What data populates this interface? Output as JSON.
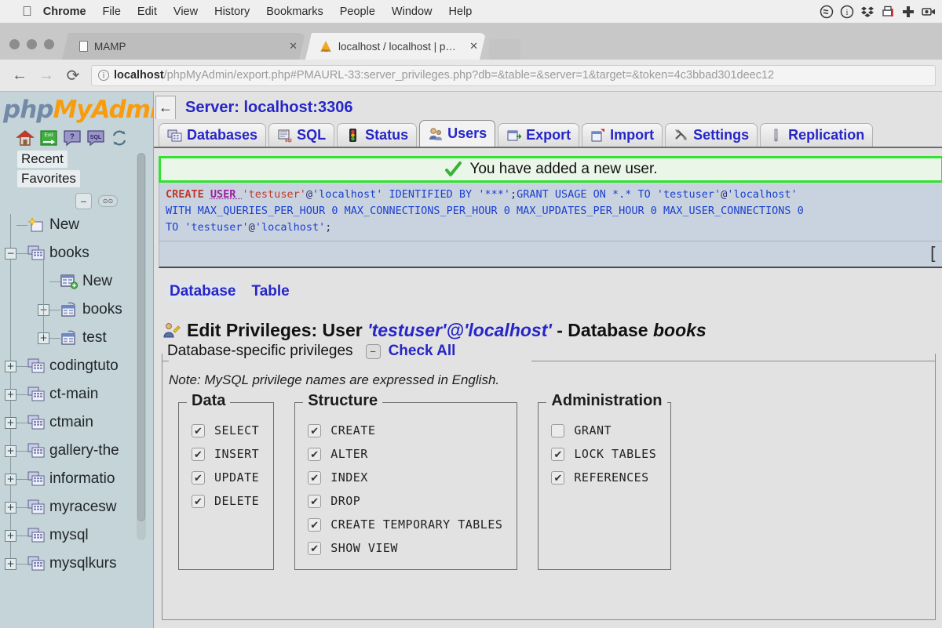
{
  "osmenu": {
    "apple": "apple-logo",
    "items": [
      "Chrome",
      "File",
      "Edit",
      "View",
      "History",
      "Bookmarks",
      "People",
      "Window",
      "Help"
    ],
    "tray": [
      "creative-cloud-icon",
      "info-circle-icon",
      "dropbox-icon",
      "printer-icon",
      "plus-cross-icon",
      "screen-record-icon"
    ]
  },
  "browser": {
    "tabs": [
      {
        "title": "MAMP",
        "close": "✕",
        "active": false
      },
      {
        "title": "localhost / localhost | phpMyA",
        "close": "✕",
        "active": true
      }
    ],
    "nav": {
      "back": "←",
      "forward": "→",
      "reload": "⟳"
    },
    "url_secure_label": "localhost",
    "url_rest": "/phpMyAdmin/export.php#PMAURL-33:server_privileges.php?db=&table=&server=1&target=&token=4c3bbad301deec12"
  },
  "sidebar": {
    "logo_php": "php",
    "logo_myadmin": "MyAdmi",
    "icons": [
      "home-icon",
      "logout-icon",
      "docs-icon",
      "sql-docs-icon",
      "reload-icon"
    ],
    "quicklinks": [
      "Recent",
      "Favorites"
    ],
    "collapse_all": "−",
    "toggle_btn": "⊙⊙",
    "tree": [
      {
        "label": "New",
        "indent": 1,
        "expander": "none",
        "icon": "new-db-icon"
      },
      {
        "label": "books",
        "indent": 1,
        "expander": "−",
        "icon": "database-icon"
      },
      {
        "label": "New",
        "indent": 2,
        "expander": "none",
        "icon": "new-table-icon"
      },
      {
        "label": "books",
        "indent": 2,
        "expander": "+",
        "icon": "table-icon"
      },
      {
        "label": "test",
        "indent": 2,
        "expander": "+",
        "icon": "table-icon"
      },
      {
        "label": "codingtuto",
        "indent": 1,
        "expander": "+",
        "icon": "database-icon"
      },
      {
        "label": "ct-main",
        "indent": 1,
        "expander": "+",
        "icon": "database-icon"
      },
      {
        "label": "ctmain",
        "indent": 1,
        "expander": "+",
        "icon": "database-icon"
      },
      {
        "label": "gallery-the",
        "indent": 1,
        "expander": "+",
        "icon": "database-icon"
      },
      {
        "label": "informatio",
        "indent": 1,
        "expander": "+",
        "icon": "database-icon"
      },
      {
        "label": "myracesw",
        "indent": 1,
        "expander": "+",
        "icon": "database-icon"
      },
      {
        "label": "mysql",
        "indent": 1,
        "expander": "+",
        "icon": "database-icon"
      },
      {
        "label": "mysqlkurs",
        "indent": 1,
        "expander": "+",
        "icon": "database-icon"
      }
    ]
  },
  "main": {
    "back_arrow": "←",
    "server_title": "Server: localhost:3306",
    "tabs": [
      {
        "label": "Databases",
        "icon": "databases-icon",
        "active": false
      },
      {
        "label": "SQL",
        "icon": "sql-icon",
        "active": false
      },
      {
        "label": "Status",
        "icon": "status-icon",
        "active": false
      },
      {
        "label": "Users",
        "icon": "users-icon",
        "active": true
      },
      {
        "label": "Export",
        "icon": "export-icon",
        "active": false
      },
      {
        "label": "Import",
        "icon": "import-icon",
        "active": false
      },
      {
        "label": "Settings",
        "icon": "settings-icon",
        "active": false
      },
      {
        "label": "Replication",
        "icon": "replication-icon",
        "active": false
      }
    ],
    "alert": {
      "icon": "green-check-icon",
      "message": "You have added a new user."
    },
    "sql": {
      "line1": [
        {
          "t": "CREATE ",
          "c": "kw"
        },
        {
          "t": "USER ",
          "c": "kw2"
        },
        {
          "t": "'testuser'",
          "c": "lit"
        },
        {
          "t": "@",
          "c": "pl"
        },
        {
          "t": "'localhost' ",
          "c": "blue"
        },
        {
          "t": "IDENTIFIED BY ",
          "c": "blue"
        },
        {
          "t": "'***'",
          "c": "blue"
        },
        {
          "t": ";",
          "c": "pl"
        },
        {
          "t": "GRANT USAGE ON *.* TO ",
          "c": "blue"
        },
        {
          "t": "'testuser'",
          "c": "blue"
        },
        {
          "t": "@",
          "c": "pl"
        },
        {
          "t": "'localhost'",
          "c": "blue"
        }
      ],
      "line2": [
        {
          "t": "WITH MAX_QUERIES_PER_HOUR 0 MAX_CONNECTIONS_PER_HOUR 0 MAX_UPDATES_PER_HOUR 0 MAX_USER_CONNECTIONS 0",
          "c": "blue"
        }
      ],
      "line3": [
        {
          "t": "TO ",
          "c": "blue"
        },
        {
          "t": "'testuser'",
          "c": "blue"
        },
        {
          "t": "@",
          "c": "pl"
        },
        {
          "t": "'localhost'",
          "c": "blue"
        },
        {
          "t": ";",
          "c": "pl"
        }
      ],
      "edit_bracket": "["
    },
    "subnav": [
      {
        "label": "Database",
        "selected": true
      },
      {
        "label": "Table",
        "selected": false
      }
    ],
    "edit_priv": {
      "icon": "user-privileges-icon",
      "prefix": "Edit Privileges: User ",
      "user": "'testuser'@'localhost'",
      "middle": " - Database ",
      "database": "books"
    },
    "fieldset": {
      "legend": "Database-specific privileges",
      "minus": "−",
      "check_all": "Check All"
    },
    "note": "Note: MySQL privilege names are expressed in English.",
    "priv_groups": [
      {
        "title": "Data",
        "items": [
          {
            "name": "SELECT",
            "checked": true
          },
          {
            "name": "INSERT",
            "checked": true
          },
          {
            "name": "UPDATE",
            "checked": true
          },
          {
            "name": "DELETE",
            "checked": true
          }
        ]
      },
      {
        "title": "Structure",
        "items": [
          {
            "name": "CREATE",
            "checked": true
          },
          {
            "name": "ALTER",
            "checked": true
          },
          {
            "name": "INDEX",
            "checked": true
          },
          {
            "name": "DROP",
            "checked": true
          },
          {
            "name": "CREATE TEMPORARY TABLES",
            "checked": true
          },
          {
            "name": "SHOW VIEW",
            "checked": true
          }
        ]
      },
      {
        "title": "Administration",
        "items": [
          {
            "name": "GRANT",
            "checked": false
          },
          {
            "name": "LOCK TABLES",
            "checked": true
          },
          {
            "name": "REFERENCES",
            "checked": true
          }
        ]
      }
    ]
  },
  "colors": {
    "link_blue": "#2626c8",
    "alert_border": "#31e231",
    "alert_bg": "#eaf6e8",
    "sql_bg": "#c9d3e0",
    "sidebar_bg": "#c5d4d8",
    "main_bg": "#e2e2e2",
    "logo_orange": "#f89c0e",
    "logo_blue": "#7289a8"
  }
}
